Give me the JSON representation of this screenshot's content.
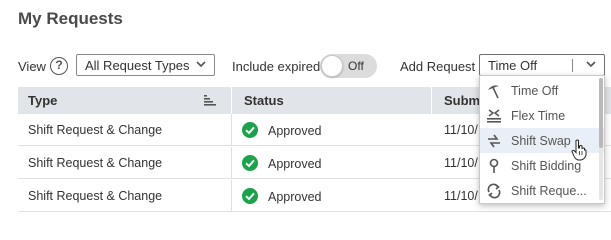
{
  "page": {
    "title": "My Requests"
  },
  "toolbar": {
    "view_label": "View",
    "help_icon": "help-circle-icon",
    "view_select": {
      "value": "All Request Types"
    },
    "include_expired_label": "Include expired",
    "include_expired_toggle": {
      "state_label": "Off",
      "checked": false
    },
    "add_request_label": "Add Request",
    "add_request_select": {
      "value": "Time Off"
    }
  },
  "table": {
    "columns": [
      {
        "label": "Type"
      },
      {
        "label": "Status"
      },
      {
        "label": "Subm"
      }
    ],
    "rows": [
      {
        "type": "Shift Request & Change",
        "status": "Approved",
        "status_icon": "check-circle-icon",
        "submitted": "11/10/"
      },
      {
        "type": "Shift Request & Change",
        "status": "Approved",
        "status_icon": "check-circle-icon",
        "submitted": "11/10/"
      },
      {
        "type": "Shift Request & Change",
        "status": "Approved",
        "status_icon": "check-circle-icon",
        "submitted": "11/10/"
      }
    ]
  },
  "dropdown": {
    "items": [
      {
        "label": "Time Off",
        "icon": "beach-umbrella-icon"
      },
      {
        "label": "Flex Time",
        "icon": "flex-time-icon"
      },
      {
        "label": "Shift Swap",
        "icon": "swap-icon",
        "hovered": true
      },
      {
        "label": "Shift Bidding",
        "icon": "pin-icon"
      },
      {
        "label": "Shift Reque...",
        "icon": "cycle-arrows-icon"
      }
    ]
  },
  "colors": {
    "header_bg": "#e1e4e8",
    "approved_green": "#1aa34a",
    "toggle_bg": "#dcdcdc",
    "hover_bg": "#e8eff7"
  }
}
